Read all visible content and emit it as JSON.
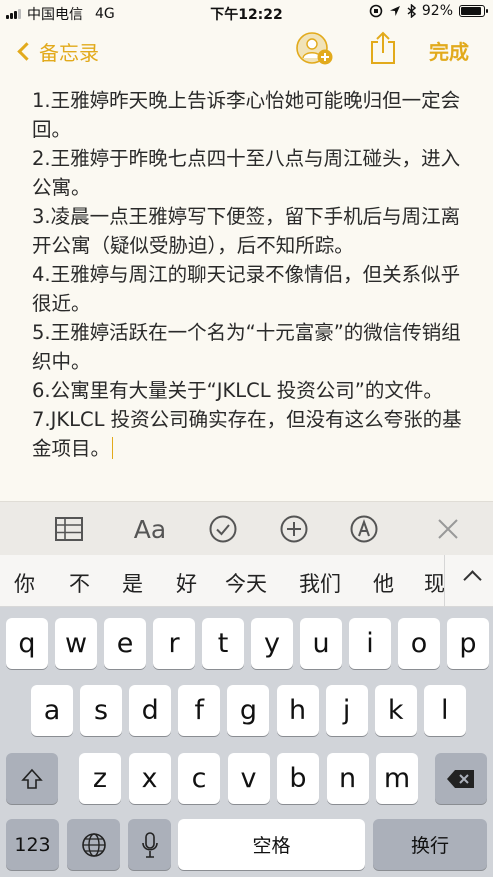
{
  "status_bar": {
    "carrier": "中国电信",
    "network": "4G",
    "time": "下午12:22",
    "battery_percent": "92%",
    "battery_level": 0.92,
    "signal_bars_active": 3,
    "signal_bars_total": 4
  },
  "nav": {
    "back_label": "备忘录",
    "done_label": "完成",
    "accent_color": "#e2aa1c"
  },
  "note": {
    "lines": [
      "1.王雅婷昨天晚上告诉李心怡她可能晚归但一定会回。",
      "2.王雅婷于昨晚七点四十至八点与周江碰头，进入公寓。",
      "3.凌晨一点王雅婷写下便签，留下手机后与周江离开公寓（疑似受胁迫），后不知所踪。",
      "4.王雅婷与周江的聊天记录不像情侣，但关系似乎很近。",
      "5.王雅婷活跃在一个名为“十元富豪”的微信传销组织中。",
      "6.公寓里有大量关于“JKLCL 投资公司”的文件。",
      "7.JKLCL 投资公司确实存在，但没有这么夸张的基金项目。"
    ]
  },
  "toolbar": {
    "icons": [
      "table-icon",
      "text-format-icon",
      "checklist-icon",
      "add-icon",
      "markup-icon",
      "close-icon"
    ],
    "format_label": "Aa"
  },
  "suggestions": {
    "items": [
      "你",
      "不",
      "是",
      "好",
      "今天",
      "我们",
      "他",
      "现"
    ]
  },
  "keyboard": {
    "row1": [
      "q",
      "w",
      "e",
      "r",
      "t",
      "y",
      "u",
      "i",
      "o",
      "p"
    ],
    "row2": [
      "a",
      "s",
      "d",
      "f",
      "g",
      "h",
      "j",
      "k",
      "l"
    ],
    "row3": [
      "z",
      "x",
      "c",
      "v",
      "b",
      "n",
      "m"
    ],
    "numbers_label": "123",
    "space_label": "空格",
    "return_label": "换行"
  }
}
